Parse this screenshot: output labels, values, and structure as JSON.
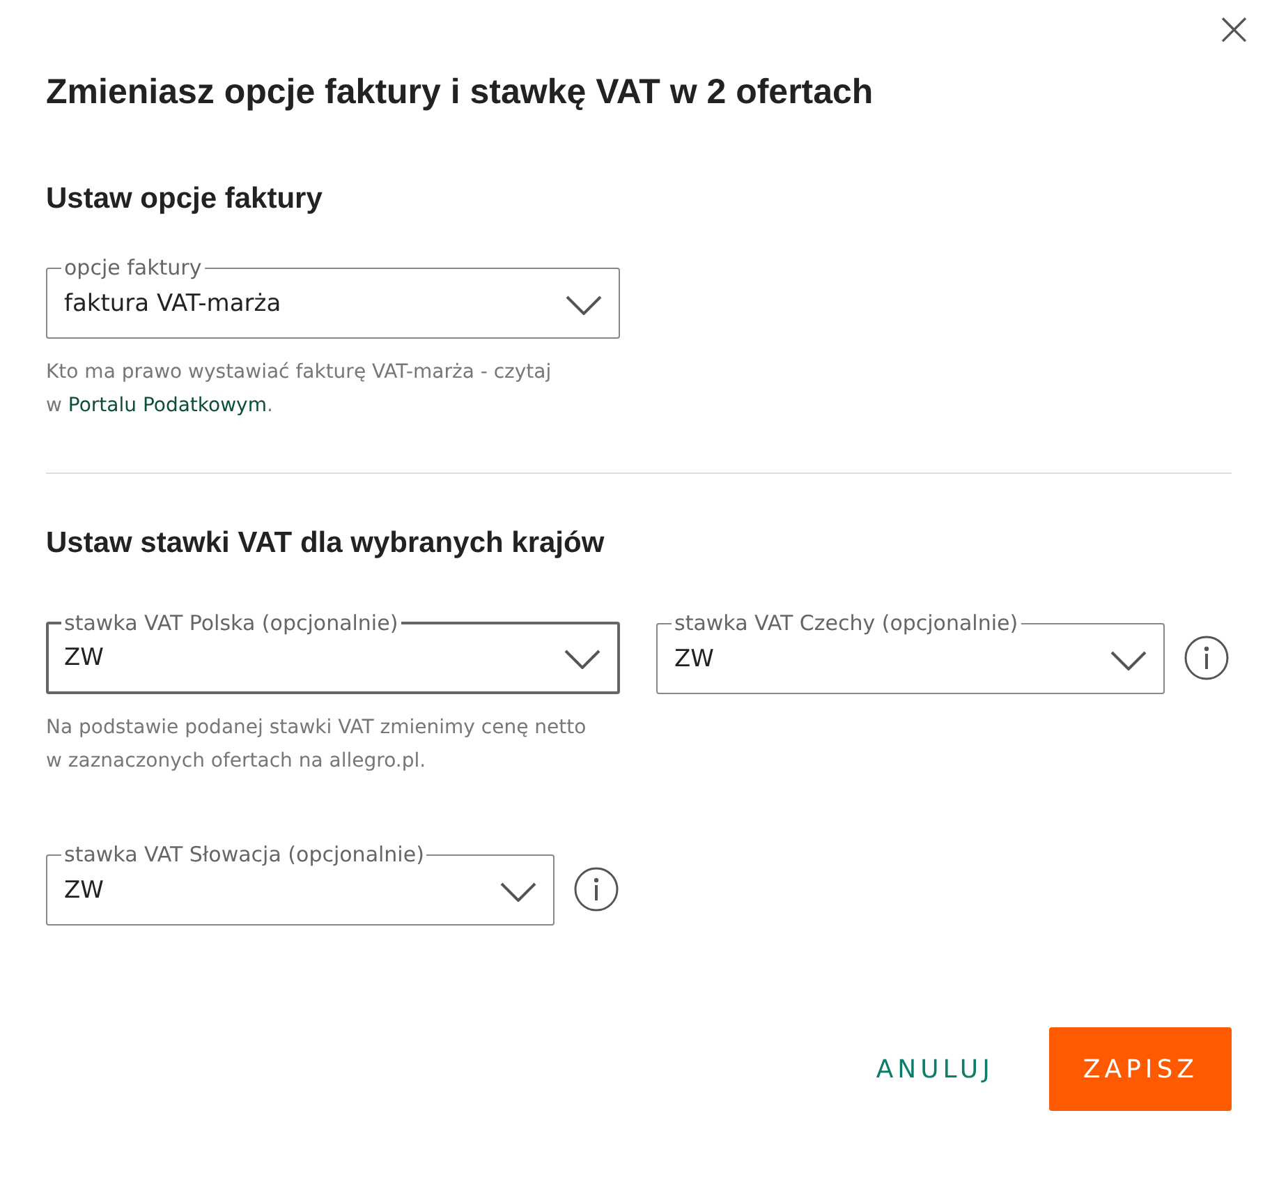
{
  "dialog": {
    "close": "×",
    "title": "Zmieniasz opcje faktury i stawkę VAT w 2 ofertach"
  },
  "invoice_section": {
    "heading": "Ustaw opcje faktury",
    "select": {
      "label": "opcje faktury",
      "value": "faktura VAT-marża",
      "focused": false,
      "info": false
    },
    "hint": {
      "text": "Kto ma prawo wystawiać fakturę VAT-marża - czytaj w ",
      "link": "Portalu Podatkowym",
      "after": "."
    }
  },
  "vat_section": {
    "heading": "Ustaw stawki VAT dla wybranych krajów",
    "selects": [
      {
        "label": "stawka VAT Polska (opcjonalnie)",
        "value": "ZW",
        "focused": true,
        "info": false,
        "hint": "Na podstawie podanej stawki VAT zmienimy cenę netto w zaznaczonych ofertach na allegro.pl."
      },
      {
        "label": "stawka VAT Czechy (opcjonalnie)",
        "value": "ZW",
        "focused": false,
        "info": true
      },
      {
        "label": "stawka VAT Słowacja (opcjonalnie)",
        "value": "ZW",
        "focused": false,
        "info": true
      }
    ]
  },
  "buttons": [
    {
      "label": "ANULUJ",
      "kind": "text"
    },
    {
      "label": "ZAPISZ",
      "kind": "primary"
    }
  ]
}
